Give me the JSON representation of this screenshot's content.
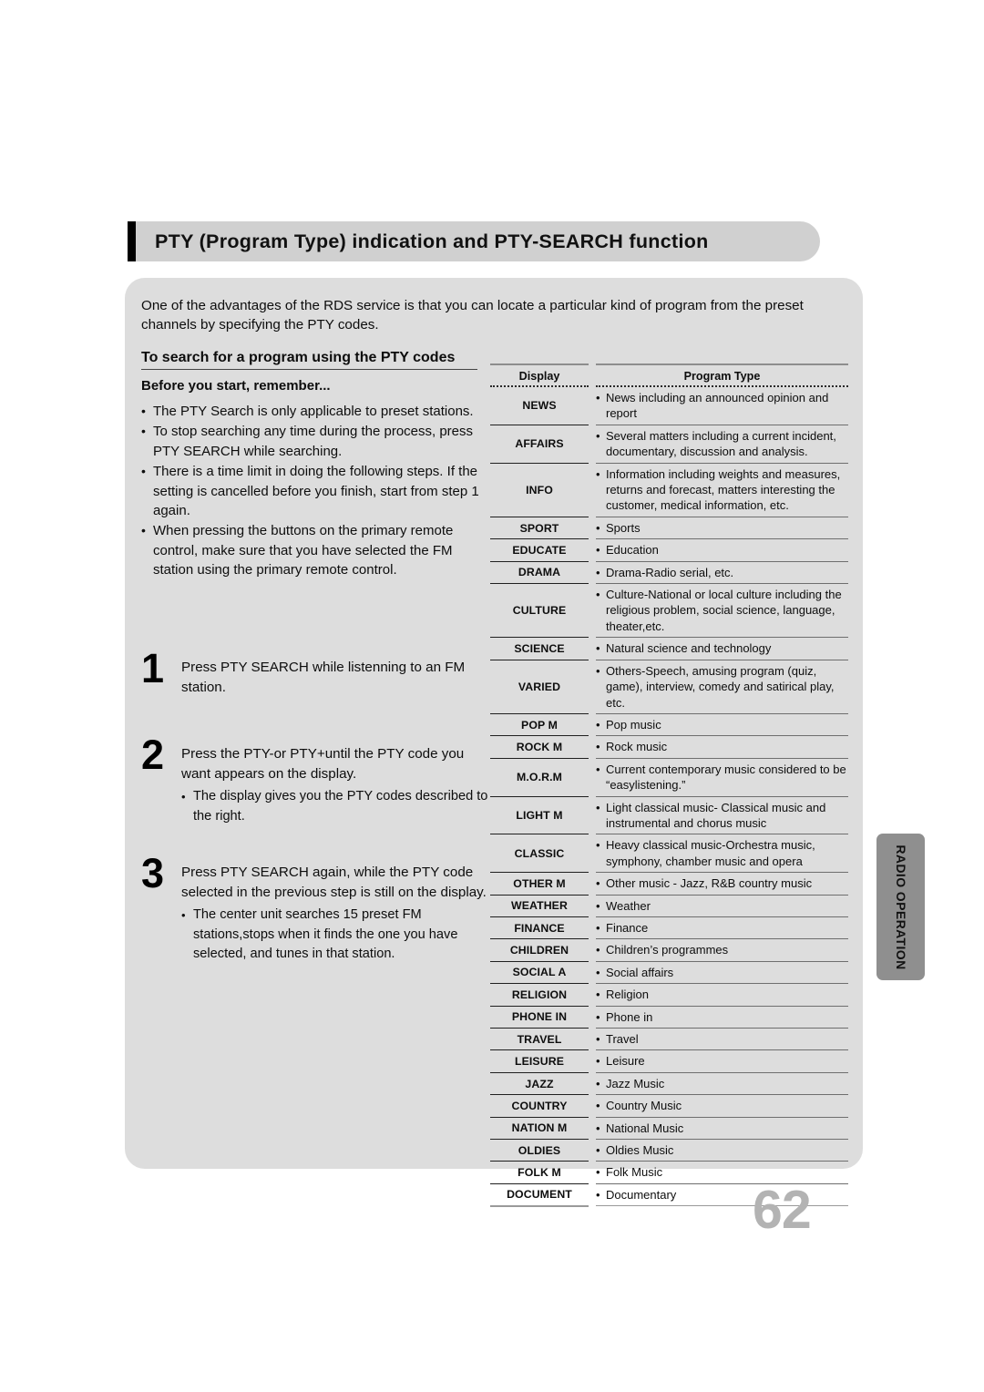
{
  "header": {
    "title": "PTY (Program Type) indication and PTY-SEARCH function"
  },
  "intro": "One  of the advantages of the RDS service is that you can locate a particular kind of program from the preset channels by specifying the PTY codes.",
  "left": {
    "section_title": "To search for a program using the PTY codes",
    "sub_title": "Before you start, remember...",
    "bullets": [
      "The PTY Search is only applicable to preset stations.",
      "To stop searching any time during the process, press PTY SEARCH while searching.",
      "There is a time limit in doing the following steps. If the setting is cancelled before you finish, start from step 1 again.",
      "When pressing the buttons on the primary remote control, make sure that you have selected the FM station using the primary remote control."
    ]
  },
  "steps": [
    {
      "num": "1",
      "text": "Press PTY SEARCH while listenning to an FM station.",
      "notes": []
    },
    {
      "num": "2",
      "text": "Press the PTY-or PTY+until the PTY code you want appears on the display.",
      "notes": [
        "The display gives you the PTY codes described to the right."
      ]
    },
    {
      "num": "3",
      "text": "Press PTY SEARCH again, while the PTY code selected in the previous step is still on the display.",
      "notes": [
        "The center unit searches 15 preset FM stations,stops when it finds the one you have selected, and tunes in that station."
      ]
    }
  ],
  "table": {
    "headers": [
      "Display",
      "Program Type"
    ],
    "rows": [
      {
        "display": "NEWS",
        "desc": "News including an announced opinion and report"
      },
      {
        "display": "AFFAIRS",
        "desc": "Several matters including a current incident, documentary, discussion and analysis."
      },
      {
        "display": "INFO",
        "desc": "Information including weights and measures, returns and forecast, matters interesting the customer, medical information, etc."
      },
      {
        "display": "SPORT",
        "desc": "Sports"
      },
      {
        "display": "EDUCATE",
        "desc": "Education"
      },
      {
        "display": "DRAMA",
        "desc": "Drama-Radio serial, etc."
      },
      {
        "display": "CULTURE",
        "desc": "Culture-National or local culture including the religious problem, social science, language, theater,etc."
      },
      {
        "display": "SCIENCE",
        "desc": "Natural science and technology"
      },
      {
        "display": "VARIED",
        "desc": "Others-Speech, amusing program (quiz, game), interview, comedy and satirical play, etc."
      },
      {
        "display": "POP M",
        "desc": "Pop music"
      },
      {
        "display": "ROCK M",
        "desc": "Rock music"
      },
      {
        "display": "M.O.R.M",
        "desc": "Current contemporary music considered to be “easylistening.”"
      },
      {
        "display": "LIGHT M",
        "desc": "Light classical music- Classical music and instrumental and chorus music"
      },
      {
        "display": "CLASSIC",
        "desc": "Heavy classical  music-Orchestra music, symphony, chamber music and opera"
      },
      {
        "display": "OTHER M",
        "desc": "Other music - Jazz, R&B country music"
      },
      {
        "display": "WEATHER",
        "desc": "Weather"
      },
      {
        "display": "FINANCE",
        "desc": "Finance"
      },
      {
        "display": "CHILDREN",
        "desc": "Children’s programmes"
      },
      {
        "display": "SOCIAL A",
        "desc": "Social affairs"
      },
      {
        "display": "RELIGION",
        "desc": "Religion"
      },
      {
        "display": "PHONE IN",
        "desc": "Phone in"
      },
      {
        "display": "TRAVEL",
        "desc": "Travel"
      },
      {
        "display": "LEISURE",
        "desc": "Leisure"
      },
      {
        "display": "JAZZ",
        "desc": "Jazz Music"
      },
      {
        "display": "COUNTRY",
        "desc": "Country Music"
      },
      {
        "display": "NATION M",
        "desc": "National Music"
      },
      {
        "display": "OLDIES",
        "desc": "Oldies Music"
      },
      {
        "display": "FOLK M",
        "desc": "Folk Music"
      },
      {
        "display": "DOCUMENT",
        "desc": "Documentary"
      }
    ]
  },
  "side_tab": {
    "label": "RADIO OPERATION"
  },
  "page_number": "62",
  "colors": {
    "header_bar": "#d0d0d0",
    "body_panel": "#dddddd",
    "side_tab": "#8f8f8f",
    "page_number": "#b3b3b3",
    "accent_bar": "#000000"
  }
}
